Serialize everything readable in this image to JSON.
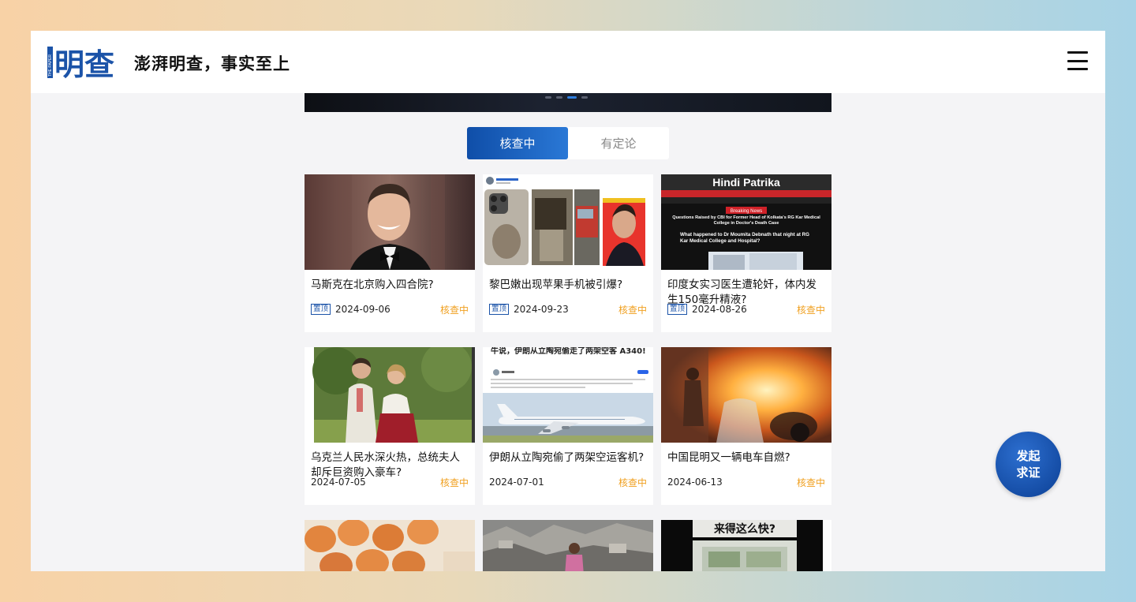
{
  "brand": {
    "logo_side_text": "THE PAPER",
    "logo_text": "明查",
    "slogan": "澎湃明查，事实至上"
  },
  "tabs": [
    {
      "label": "核查中",
      "active": true
    },
    {
      "label": "有定论",
      "active": false
    }
  ],
  "pin_label": "置顶",
  "cards": [
    {
      "title": "马斯克在北京购入四合院?",
      "date": "2024-09-06",
      "status": "核查中",
      "pinned": true,
      "thumb_icon": "portrait-photo"
    },
    {
      "title": "黎巴嫩出现苹果手机被引爆?",
      "date": "2024-09-23",
      "status": "核查中",
      "pinned": true,
      "thumb_icon": "burnt-phone-photo"
    },
    {
      "title": "印度女实习医生遭轮奸，体内发生150毫升精液?",
      "date": "2024-08-26",
      "status": "核查中",
      "pinned": true,
      "thumb_icon": "news-page-screenshot",
      "thumb_text": {
        "masthead": "Hindi Patrika",
        "breaking": "Breaking News",
        "headline": "Questions Raised by CBI for Former Head of Kolkata's RG Kar Medical College in Doctor's Death Case",
        "sub": "What happened to Dr Moumita Debnath that night at RG Kar Medical College and Hospital?"
      }
    },
    {
      "title": "乌克兰人民水深火热，总统夫人却斥巨资购入豪车?",
      "date": "2024-07-05",
      "status": "核查中",
      "pinned": false,
      "thumb_icon": "couple-photo"
    },
    {
      "title": "伊朗从立陶宛偷了两架空运客机?",
      "date": "2024-07-01",
      "status": "核查中",
      "pinned": false,
      "thumb_icon": "airplane-post-screenshot",
      "thumb_text": {
        "post_heading": "牛说，伊朗从立陶宛偷走了两架空客 A340!"
      }
    },
    {
      "title": "中国昆明又一辆电车自燃?",
      "date": "2024-06-13",
      "status": "核查中",
      "pinned": false,
      "thumb_icon": "car-fire-photo"
    },
    {
      "title": "",
      "date": "",
      "status": "",
      "pinned": false,
      "thumb_icon": "eggs-photo"
    },
    {
      "title": "",
      "date": "",
      "status": "",
      "pinned": false,
      "thumb_icon": "rubble-photo"
    },
    {
      "title": "",
      "date": "",
      "status": "",
      "pinned": false,
      "thumb_icon": "video-frame",
      "thumb_text": {
        "caption": "来得这么快?"
      }
    }
  ],
  "fab": {
    "line1": "发起",
    "line2": "求证"
  },
  "colors": {
    "brand_blue": "#1b53a8",
    "status_orange": "#f0a020"
  }
}
